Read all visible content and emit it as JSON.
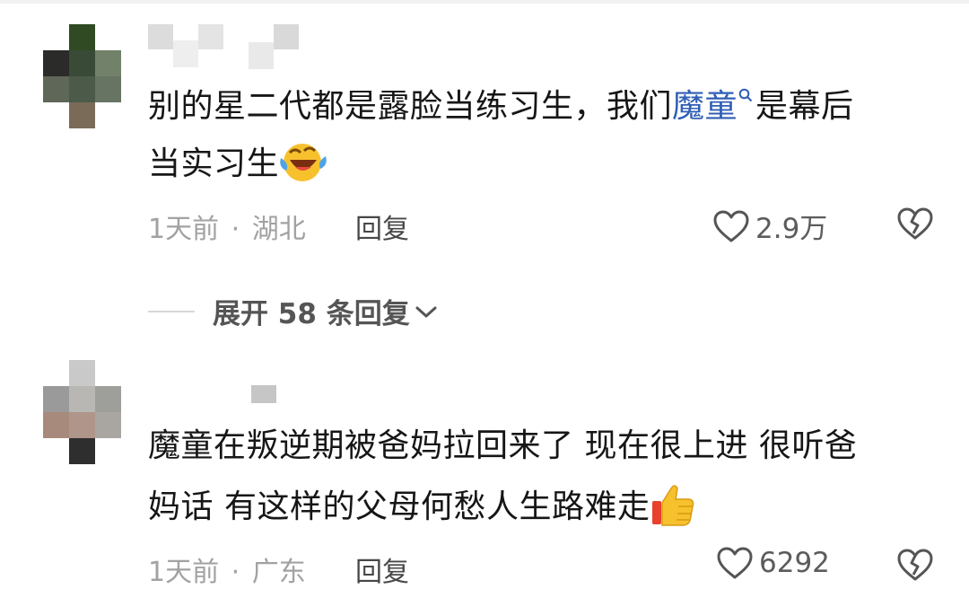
{
  "comments": [
    {
      "text_lines": [
        "别的星二代都是露脸当练习生，我们",
        "是幕后",
        "当实习生"
      ],
      "keyword": "魔童",
      "time": "1天前",
      "location": "湖北",
      "reply_label": "回复",
      "likes": "2.9万",
      "emoji": "laughing-crying-emoji"
    },
    {
      "text_lines": [
        "魔童在叛逆期被爸妈拉回来了 现在很上进 很听爸",
        "妈话 有这样的父母何愁人生路难走"
      ],
      "time": "1天前",
      "location": "广东",
      "reply_label": "回复",
      "likes": "6292",
      "emoji": "thumbs-up-emoji"
    }
  ],
  "expand_replies": "展开 58 条回复",
  "separator": "·",
  "icons": {
    "like": "heart-outline-icon",
    "dislike": "broken-heart-icon",
    "expand": "chevron-down-icon",
    "keyword_search": "search-icon"
  },
  "colors": {
    "keyword": "#2f5eb5",
    "meta": "#a2a2a2",
    "text": "#161616"
  }
}
